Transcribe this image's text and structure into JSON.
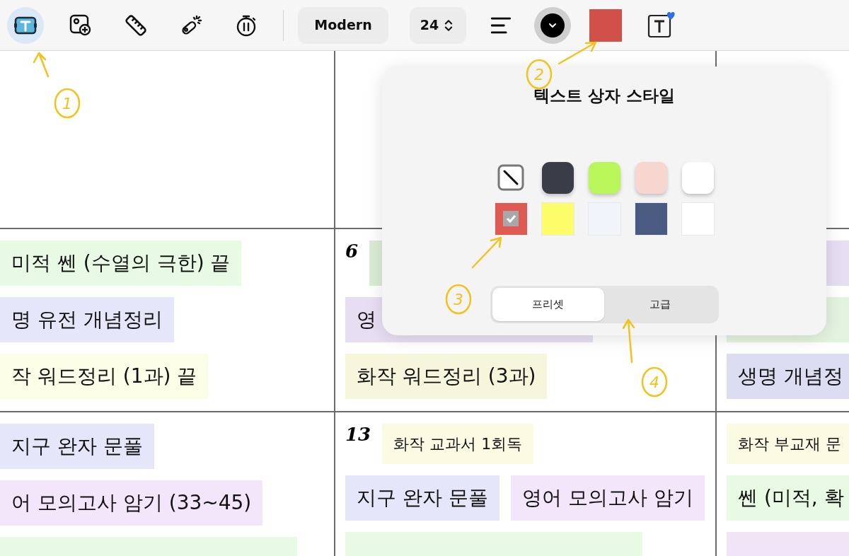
{
  "toolbar": {
    "tools": [
      {
        "kind": "text",
        "selected": true
      },
      {
        "kind": "image",
        "selected": false
      },
      {
        "kind": "ruler",
        "selected": false
      },
      {
        "kind": "laser",
        "selected": false
      },
      {
        "kind": "timer",
        "selected": false
      }
    ],
    "font_style": "Modern",
    "font_size": "24",
    "text_color": {
      "color": "#000000"
    },
    "fill_color": {
      "color": "#d2504a"
    }
  },
  "planner": {
    "rows": [
      {
        "cells": [
          {},
          {},
          {}
        ]
      },
      {
        "cells": [
          {
            "notes": [
              {
                "text": "미적 쎈 (수열의 극한) 끝",
                "color": "#e8f9e4",
                "kind": "large"
              },
              {
                "text": "명 유전 개념정리",
                "color": "#e6e6fb",
                "kind": "large"
              },
              {
                "text": "작 워드정리 (1과) 끝",
                "color": "#fbfde6",
                "kind": "large"
              }
            ]
          },
          {
            "day": "6",
            "notes": [
              {
                "color": "#dbecd6",
                "kind": "blank"
              },
              {
                "text": "영",
                "color": "#e7def3",
                "kind": "wide"
              },
              {
                "text": "화작 워드정리 (3과)",
                "color": "#f6f6dc",
                "kind": "large"
              }
            ]
          },
          {
            "notes": [
              {
                "color": "#e6def3",
                "kind": "blank"
              },
              {
                "color": "#e4f3df",
                "kind": "blank"
              },
              {
                "text": "생명 개념정",
                "color": "#dcdcf2",
                "kind": "large"
              }
            ]
          }
        ]
      },
      {
        "cells": [
          {
            "notes": [
              {
                "text": "지구 완자 문풀",
                "color": "#e6e6fb",
                "kind": "large"
              },
              {
                "text": "어 모의고사 암기 (33~45)",
                "color": "#f3e6fb",
                "kind": "large"
              },
              {
                "color": "#e8f9e4",
                "kind": "blank"
              }
            ]
          },
          {
            "day": "13",
            "notes": [
              {
                "text": "화작 교과서 1회독",
                "color": "#fbfbe4",
                "kind": "small"
              },
              {
                "text": "지구 완자 문풀",
                "color": "#e6e6fb",
                "kind": "large"
              },
              {
                "text": "영어 모의고사 암기",
                "color": "#f3e6fb",
                "kind": "large"
              },
              {
                "color": "#e8f9e4",
                "kind": "blank"
              }
            ]
          },
          {
            "notes": [
              {
                "text": "화작 부교재 문",
                "color": "#fbfbe4",
                "kind": "small"
              },
              {
                "text": "쎈 (미적, 확",
                "color": "#e8f9e4",
                "kind": "large"
              },
              {
                "color": "#f0e4f6",
                "kind": "blank"
              }
            ]
          }
        ]
      }
    ]
  },
  "popover": {
    "title": "텍스트 상자 스타일",
    "swatches": [
      {
        "kind": "none",
        "selected": false
      },
      {
        "kind": "rounded",
        "color": "#3a3d47",
        "selected": false
      },
      {
        "kind": "rounded",
        "color": "#b8f65a",
        "selected": false
      },
      {
        "kind": "rounded",
        "color": "#f6d6cf",
        "selected": false
      },
      {
        "kind": "rounded",
        "color": "#ffffff",
        "selected": false
      },
      {
        "kind": "square",
        "color": "#e05a54",
        "selected": true
      },
      {
        "kind": "square",
        "color": "#fdfd6a",
        "selected": false
      },
      {
        "kind": "square",
        "color": "#f1f5fb",
        "selected": false
      },
      {
        "kind": "square",
        "color": "#4b5a80",
        "selected": false
      },
      {
        "kind": "square",
        "color": "#ffffff",
        "selected": false
      }
    ],
    "segments": [
      {
        "label": "프리셋",
        "selected": true
      },
      {
        "label": "고급",
        "selected": false
      }
    ]
  },
  "annotations": [
    {
      "label": "1"
    },
    {
      "label": "2"
    },
    {
      "label": "3"
    },
    {
      "label": "4"
    }
  ]
}
